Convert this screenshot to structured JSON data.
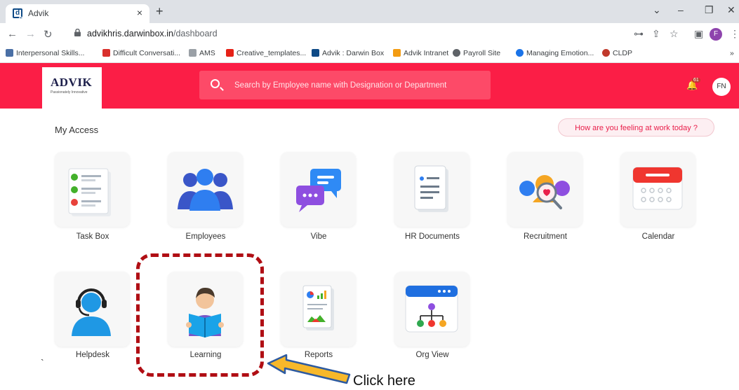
{
  "browser": {
    "tab_title": "Advik",
    "url_host": "advikhris.darwinbox.in",
    "url_path": "/dashboard",
    "profile_initial": "F",
    "bookmarks": [
      "Interpersonal Skills...",
      "Difficult Conversati...",
      "AMS",
      "Creative_templates...",
      "Advik : Darwin Box",
      "Advik Intranet",
      "Payroll Site",
      "Managing Emotion...",
      "CLDP"
    ],
    "more_bookmarks": "»"
  },
  "header": {
    "logo_text": "ADVIK",
    "logo_tagline": "Passionately Innovative",
    "search_placeholder": "Search by Employee name with Designation or Department",
    "notification_count": "61",
    "user_initials": "FN",
    "accent_color": "#fb1e46"
  },
  "main": {
    "section_title": "My Access",
    "mood_prompt": "How are you feeling at work today ?",
    "tiles": [
      {
        "label": "Task Box",
        "icon": "task-list-icon"
      },
      {
        "label": "Employees",
        "icon": "employees-group-icon"
      },
      {
        "label": "Vibe",
        "icon": "chat-bubbles-icon"
      },
      {
        "label": "HR Documents",
        "icon": "document-icon"
      },
      {
        "label": "Recruitment",
        "icon": "recruitment-search-icon"
      },
      {
        "label": "Calendar",
        "icon": "calendar-icon"
      },
      {
        "label": "Helpdesk",
        "icon": "headset-person-icon"
      },
      {
        "label": "Learning",
        "icon": "reading-person-icon"
      },
      {
        "label": "Reports",
        "icon": "report-charts-icon"
      },
      {
        "label": "Org View",
        "icon": "org-chart-icon"
      }
    ]
  },
  "annotation": {
    "callout": "Click here",
    "stray_mark": "`",
    "color": "#b00e14"
  }
}
